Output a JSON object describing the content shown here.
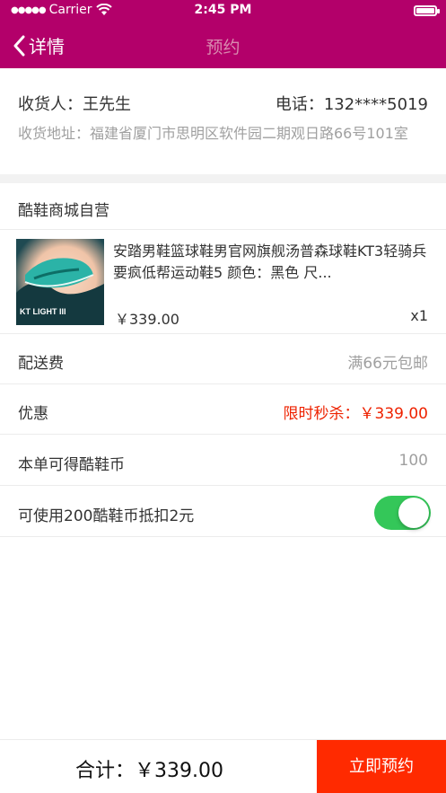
{
  "status_bar": {
    "carrier": "Carrier",
    "time": "2:45 PM"
  },
  "nav": {
    "back_label": "详情",
    "title": "预约"
  },
  "receiver": {
    "name": "收货人：王先生",
    "phone": "电话：132****5019",
    "address": "收货地址：福建省厦门市思明区软件园二期观日路66号101室"
  },
  "shop": {
    "name": "酷鞋商城自营"
  },
  "product": {
    "title": "安踏男鞋篮球鞋男官网旗舰汤普森球鞋KT3轻骑兵要疯低帮运动鞋5  颜色：黑色 尺...",
    "image_text": "KT LIGHT III",
    "price": "￥339.00",
    "quantity": "x1"
  },
  "rows": {
    "shipping": {
      "label": "配送费",
      "value": "满66元包邮"
    },
    "discount": {
      "label": "优惠",
      "value": "限时秒杀：￥339.00"
    },
    "coins": {
      "label": "本单可得酷鞋币",
      "value": "100"
    },
    "use_coins": {
      "label": "可使用200酷鞋币抵扣2元",
      "enabled": true
    }
  },
  "footer": {
    "total": "合计：￥339.00",
    "submit_label": "立即预约"
  },
  "colors": {
    "brand": "#b3006a",
    "accent_red": "#ff2a00",
    "toggle_on": "#34c759"
  }
}
